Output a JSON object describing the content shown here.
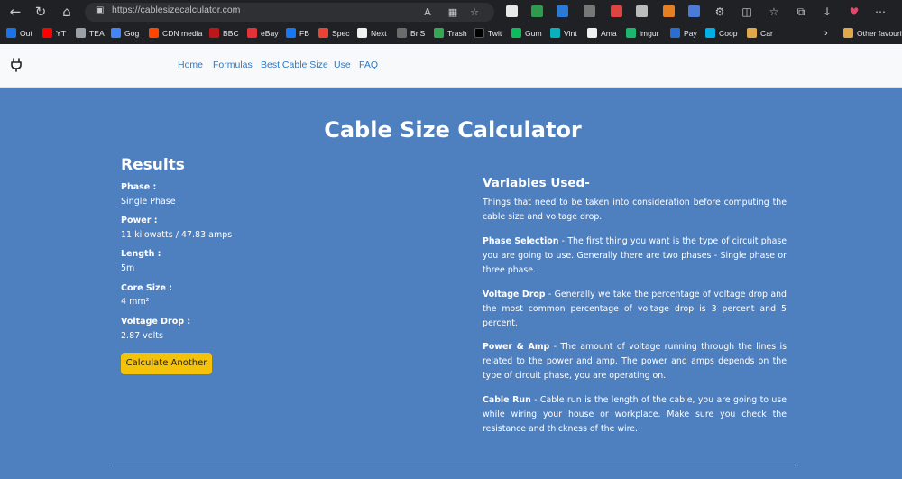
{
  "browser": {
    "url": "https://cablesizecalculator.com",
    "bookmarks": [
      {
        "label": "Out",
        "color": "#1a73e8"
      },
      {
        "label": "YT",
        "color": "#ff0000"
      },
      {
        "label": "TEA",
        "color": "#9aa0a6"
      },
      {
        "label": "Gog",
        "color": "#4285f4"
      },
      {
        "label": "CDN media",
        "color": "#ff4500"
      },
      {
        "label": "BBC",
        "color": "#bb1919"
      },
      {
        "label": "eBay",
        "color": "#e53238"
      },
      {
        "label": "FB",
        "color": "#1877f2"
      },
      {
        "label": "Spec",
        "color": "#ea4335"
      },
      {
        "label": "Next",
        "color": "#ffffff"
      },
      {
        "label": "BriS",
        "color": "#6b6b6b"
      },
      {
        "label": "Trash",
        "color": "#34a853"
      },
      {
        "label": "Twit",
        "color": "#000000"
      },
      {
        "label": "Gum",
        "color": "#0dbd5c"
      },
      {
        "label": "Vint",
        "color": "#09b1ba"
      },
      {
        "label": "Ama",
        "color": "#232f3e"
      },
      {
        "label": "imgur",
        "color": "#1bb76e"
      },
      {
        "label": "Pay",
        "color": "#003087"
      },
      {
        "label": "Coop",
        "color": "#00b1e7"
      },
      {
        "label": "Car",
        "color": "#e0a84a"
      }
    ],
    "other_favourites": "Other favourit"
  },
  "nav": {
    "links": [
      "Home",
      "Formulas",
      "Best Cable Size",
      "Use",
      "FAQ"
    ]
  },
  "main": {
    "title": "Cable Size Calculator",
    "results_heading": "Results",
    "fields": [
      {
        "label": "Phase :",
        "value": "Single Phase"
      },
      {
        "label": "Power :",
        "value": "11 kilowatts / 47.83 amps"
      },
      {
        "label": "Length :",
        "value": "5m"
      },
      {
        "label": "Core Size :",
        "value": "4 mm²"
      },
      {
        "label": "Voltage Drop :",
        "value": "2.87 volts"
      }
    ],
    "calc_button": "Calculate Another",
    "vars_heading": "Variables Used-",
    "intro": "Things that need to be taken into consideration before computing the cable size and voltage drop.",
    "items": [
      {
        "term": "Phase Selection",
        "text": " - The first thing you want is the type of circuit phase you are going to use. Generally there are two phases - Single phase or three phase."
      },
      {
        "term": "Voltage Drop",
        "text": " - Generally we take the percentage of voltage drop and the most common percentage of voltage drop is 3 percent and 5 percent."
      },
      {
        "term": "Power & Amp",
        "text": " - The amount of voltage running through the lines is related to the power and amp. The power and amps depends on the type of circuit phase, you are operating on."
      },
      {
        "term": "Cable Run",
        "text": " - Cable run is the length of the cable, you are going to use while wiring your house or workplace. Make sure you check the resistance and thickness of the wire."
      }
    ]
  }
}
